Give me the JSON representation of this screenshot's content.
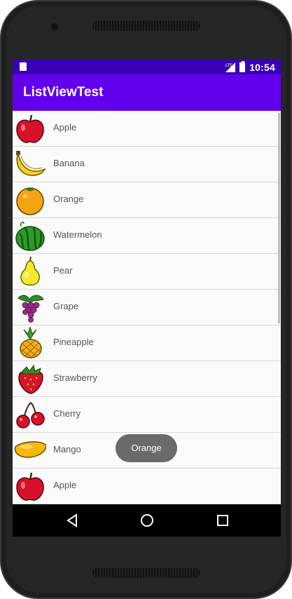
{
  "status_bar": {
    "time": "10:54",
    "network": "LTE"
  },
  "app_bar": {
    "title": "ListViewTest"
  },
  "list": {
    "items": [
      {
        "label": "Apple",
        "icon": "apple-icon"
      },
      {
        "label": "Banana",
        "icon": "banana-icon"
      },
      {
        "label": "Orange",
        "icon": "orange-icon"
      },
      {
        "label": "Watermelon",
        "icon": "watermelon-icon"
      },
      {
        "label": "Pear",
        "icon": "pear-icon"
      },
      {
        "label": "Grape",
        "icon": "grape-icon"
      },
      {
        "label": "Pineapple",
        "icon": "pineapple-icon"
      },
      {
        "label": "Strawberry",
        "icon": "strawberry-icon"
      },
      {
        "label": "Cherry",
        "icon": "cherry-icon"
      },
      {
        "label": "Mango",
        "icon": "mango-icon"
      },
      {
        "label": "Apple",
        "icon": "apple-icon"
      }
    ]
  },
  "toast": {
    "text": "Orange"
  },
  "colors": {
    "status_bar": "#3a00b6",
    "app_bar": "#6200ee",
    "toast": "#6a6a6a"
  }
}
